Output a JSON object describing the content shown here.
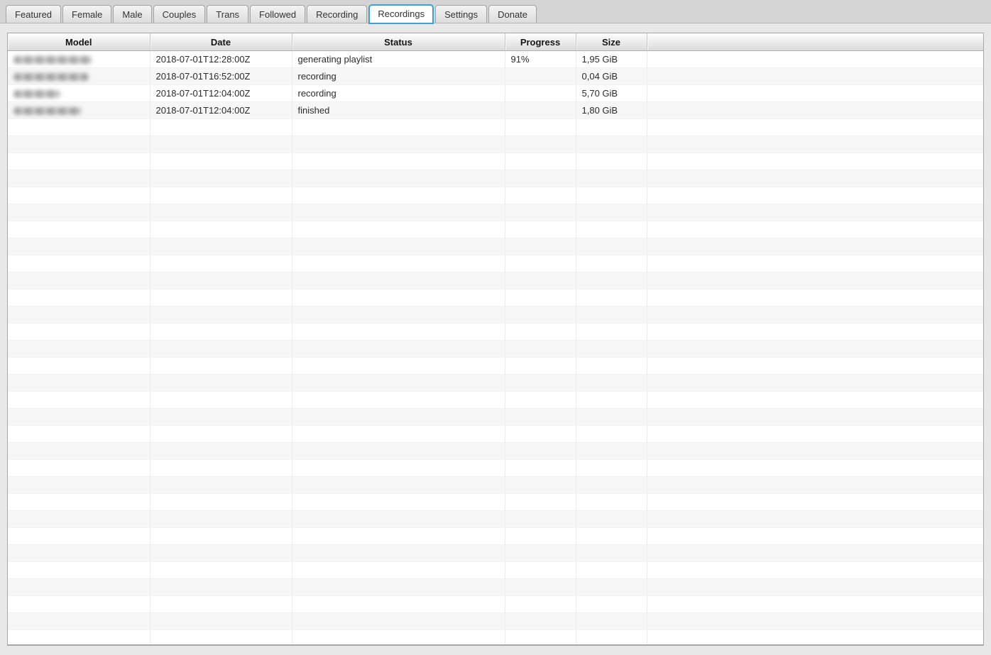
{
  "tab_bar": {
    "active_tab": "Recordings",
    "tabs": [
      {
        "id": "featured",
        "label": "Featured",
        "active": false
      },
      {
        "id": "female",
        "label": "Female",
        "active": false
      },
      {
        "id": "male",
        "label": "Male",
        "active": false
      },
      {
        "id": "couples",
        "label": "Couples",
        "active": false
      },
      {
        "id": "trans",
        "label": "Trans",
        "active": false
      },
      {
        "id": "followed",
        "label": "Followed",
        "active": false
      },
      {
        "id": "recording",
        "label": "Recording",
        "active": false
      },
      {
        "id": "recordings",
        "label": "Recordings",
        "active": true
      },
      {
        "id": "settings",
        "label": "Settings",
        "active": false
      },
      {
        "id": "donate",
        "label": "Donate",
        "active": false
      }
    ]
  },
  "recordings_table": {
    "columns": [
      {
        "id": "model",
        "label": "Model"
      },
      {
        "id": "date",
        "label": "Date"
      },
      {
        "id": "status",
        "label": "Status"
      },
      {
        "id": "progress",
        "label": "Progress"
      },
      {
        "id": "size",
        "label": "Size"
      },
      {
        "id": "filler",
        "label": ""
      }
    ],
    "rows": [
      {
        "model_redacted": true,
        "model_blur_width": 111,
        "date": "2018-07-01T12:28:00Z",
        "status": "generating playlist",
        "progress": "91%",
        "size": "1,95 GiB"
      },
      {
        "model_redacted": true,
        "model_blur_width": 106,
        "date": "2018-07-01T16:52:00Z",
        "status": "recording",
        "progress": "",
        "size": "0,04 GiB"
      },
      {
        "model_redacted": true,
        "model_blur_width": 66,
        "date": "2018-07-01T12:04:00Z",
        "status": "recording",
        "progress": "",
        "size": "5,70 GiB"
      },
      {
        "model_redacted": true,
        "model_blur_width": 96,
        "date": "2018-07-01T12:04:00Z",
        "status": "finished",
        "progress": "",
        "size": "1,80 GiB"
      }
    ],
    "empty_row_count": 31
  },
  "colors": {
    "accent_blue": "#3ba1d6",
    "row_stripe": "#f6f6f6",
    "tab_bar_background": "#d4d4d4",
    "window_background": "#e8e8e8"
  }
}
